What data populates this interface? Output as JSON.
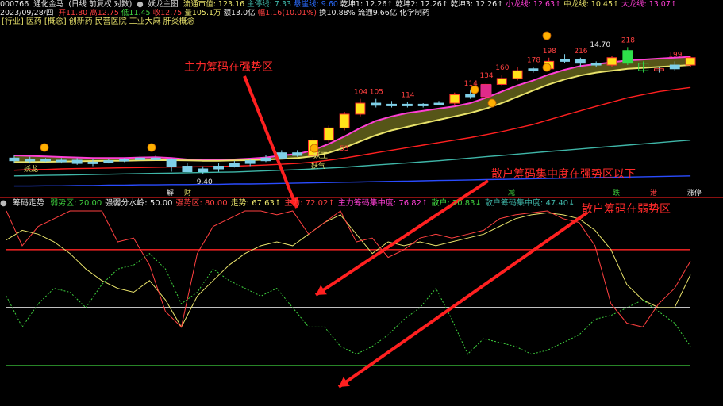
{
  "header": {
    "stock_code": "000766",
    "stock_name": "通化金马",
    "period": "(日线 前复权 对数)",
    "indicator_name": "妖龙主图",
    "items": [
      {
        "label": "流通市值: 123.16",
        "color": "#e8e26a"
      },
      {
        "label": "主停线: 7.33",
        "color": "#3fb6a8"
      },
      {
        "label": "悬崖线: 9.60",
        "color": "#2a6cff"
      },
      {
        "label": "乾坤1: 12.26↑",
        "color": "#e8e8e8"
      },
      {
        "label": "乾坤2: 12.26↑",
        "color": "#e8e8e8"
      },
      {
        "label": "乾坤3: 12.26↑",
        "color": "#e8e8e8"
      },
      {
        "label": "小龙线: 12.63↑",
        "color": "#ff3fd6"
      },
      {
        "label": "中龙线: 10.45↑",
        "color": "#e8e26a"
      },
      {
        "label": "大龙线: 13.07↑",
        "color": "#ff3fd6"
      }
    ]
  },
  "header2": {
    "date": "2023/09/28/四",
    "items": [
      {
        "label": "开11.80",
        "color": "#ff4040"
      },
      {
        "label": "高12.75",
        "color": "#ff4040"
      },
      {
        "label": "低11.45",
        "color": "#3fd23f"
      },
      {
        "label": "收12.75",
        "color": "#ff4040"
      },
      {
        "label": "量105.1万",
        "color": "#e8e26a"
      },
      {
        "label": "额13.0亿",
        "color": "#e8e8e8"
      },
      {
        "label": "幅1.16(10.01%)",
        "color": "#ff4040"
      },
      {
        "label": "换10.88%",
        "color": "#e8e8e8"
      },
      {
        "label": "流通9.66亿",
        "color": "#e8e8e8"
      },
      {
        "label": "化学制药",
        "color": "#e8e8e8"
      }
    ]
  },
  "concept_row": [
    "[行业]",
    "医药",
    "[概念]",
    "创新药",
    "民营医院",
    "工业大麻",
    "肝炎概念"
  ],
  "annotations": {
    "main_chip_strong": "主力筹码在强势区",
    "retail_below": "散户筹码集中度在强势区以下",
    "retail_weak": "散户筹码在弱势区"
  },
  "bottom_markers": [
    {
      "text": "解",
      "color": "#e8e8e8"
    },
    {
      "text": "财",
      "color": "#e8e26a"
    },
    {
      "text": "减",
      "color": "#3fd23f"
    },
    {
      "text": "跌",
      "color": "#3fd23f"
    },
    {
      "text": "港",
      "color": "#ff4040"
    },
    {
      "text": "涨停",
      "color": "#e8e8e8"
    }
  ],
  "sub_header": {
    "name": "筹码走势",
    "items": [
      {
        "label": "弱势区: 20.00",
        "color": "#3fd23f"
      },
      {
        "label": "强弱分水岭: 50.00",
        "color": "#e8e8e8"
      },
      {
        "label": "强势区: 80.00",
        "color": "#ff4040"
      },
      {
        "label": "走势: 67.63↑",
        "color": "#e8e26a"
      },
      {
        "label": "主力: 72.02↑",
        "color": "#ff4040"
      },
      {
        "label": "主力筹码集中度: 76.82↑",
        "color": "#ff3fd6"
      },
      {
        "label": "散户: 20.83↓",
        "color": "#3fd23f"
      },
      {
        "label": "散户筹码集中度: 47.40↓",
        "color": "#3fb6a8"
      }
    ]
  },
  "chart_data": [
    {
      "type": "candlestick",
      "title": "妖龙主图",
      "price_labels": [
        {
          "text": "53",
          "color": "#ff4040"
        },
        {
          "text": "104",
          "color": "#ff4040"
        },
        {
          "text": "105",
          "color": "#ff4040"
        },
        {
          "text": "114",
          "color": "#ff4040"
        },
        {
          "text": "114",
          "color": "#ff4040"
        },
        {
          "text": "134",
          "color": "#ff4040"
        },
        {
          "text": "160",
          "color": "#ff4040"
        },
        {
          "text": "178",
          "color": "#ff4040"
        },
        {
          "text": "198",
          "color": "#ff4040"
        },
        {
          "text": "216",
          "color": "#ff4040"
        },
        {
          "text": "14.70",
          "color": "#e8e8e8"
        },
        {
          "text": "218",
          "color": "#ff4040"
        },
        {
          "text": "199",
          "color": "#ff4040"
        },
        {
          "text": "9.40",
          "color": "#e8e8e8"
        }
      ],
      "text_marks": [
        "妖王",
        "妖气",
        "妖龙"
      ],
      "candles": [
        {
          "o": 9.9,
          "c": 9.8,
          "h": 10.0,
          "l": 9.7
        },
        {
          "o": 9.8,
          "c": 9.85,
          "h": 9.95,
          "l": 9.7
        },
        {
          "o": 9.85,
          "c": 9.8,
          "h": 9.9,
          "l": 9.75
        },
        {
          "o": 9.8,
          "c": 9.82,
          "h": 9.9,
          "l": 9.7
        },
        {
          "o": 9.82,
          "c": 9.7,
          "h": 9.9,
          "l": 9.65
        },
        {
          "o": 9.7,
          "c": 9.75,
          "h": 9.85,
          "l": 9.6
        },
        {
          "o": 9.75,
          "c": 9.8,
          "h": 9.85,
          "l": 9.7
        },
        {
          "o": 9.8,
          "c": 9.85,
          "h": 9.9,
          "l": 9.75
        },
        {
          "o": 9.85,
          "c": 9.9,
          "h": 10.0,
          "l": 9.8
        },
        {
          "o": 9.9,
          "c": 9.85,
          "h": 10.0,
          "l": 9.8
        },
        {
          "o": 9.85,
          "c": 9.6,
          "h": 9.9,
          "l": 9.4
        },
        {
          "o": 9.6,
          "c": 9.4,
          "h": 9.7,
          "l": 9.4
        },
        {
          "o": 9.4,
          "c": 9.5,
          "h": 9.6,
          "l": 9.3
        },
        {
          "o": 9.5,
          "c": 9.6,
          "h": 9.7,
          "l": 9.4
        },
        {
          "o": 9.6,
          "c": 9.7,
          "h": 9.8,
          "l": 9.55
        },
        {
          "o": 9.7,
          "c": 9.8,
          "h": 9.85,
          "l": 9.6
        },
        {
          "o": 9.8,
          "c": 9.9,
          "h": 10.0,
          "l": 9.75
        },
        {
          "o": 9.9,
          "c": 10.1,
          "h": 10.2,
          "l": 9.85
        },
        {
          "o": 10.1,
          "c": 10.0,
          "h": 10.2,
          "l": 9.95
        },
        {
          "o": 10.0,
          "c": 10.6,
          "h": 10.7,
          "l": 9.9
        },
        {
          "o": 10.6,
          "c": 11.1,
          "h": 11.2,
          "l": 10.5
        },
        {
          "o": 11.1,
          "c": 11.7,
          "h": 11.8,
          "l": 11.0
        },
        {
          "o": 11.7,
          "c": 12.2,
          "h": 12.4,
          "l": 11.6
        },
        {
          "o": 12.2,
          "c": 12.1,
          "h": 12.4,
          "l": 12.0
        },
        {
          "o": 12.1,
          "c": 12.15,
          "h": 12.3,
          "l": 12.0
        },
        {
          "o": 12.15,
          "c": 12.1,
          "h": 12.25,
          "l": 12.0
        },
        {
          "o": 12.1,
          "c": 12.15,
          "h": 12.2,
          "l": 12.0
        },
        {
          "o": 12.15,
          "c": 12.2,
          "h": 12.3,
          "l": 12.1
        },
        {
          "o": 12.2,
          "c": 12.6,
          "h": 12.7,
          "l": 12.1
        },
        {
          "o": 12.6,
          "c": 12.5,
          "h": 12.8,
          "l": 12.4
        },
        {
          "o": 12.5,
          "c": 13.1,
          "h": 13.2,
          "l": 12.4
        },
        {
          "o": 13.1,
          "c": 13.4,
          "h": 13.6,
          "l": 13.0
        },
        {
          "o": 13.4,
          "c": 13.8,
          "h": 14.0,
          "l": 13.3
        },
        {
          "o": 13.8,
          "c": 13.9,
          "h": 14.0,
          "l": 13.7
        },
        {
          "o": 13.9,
          "c": 14.3,
          "h": 14.5,
          "l": 13.8
        },
        {
          "o": 14.3,
          "c": 14.4,
          "h": 14.7,
          "l": 14.2
        },
        {
          "o": 14.4,
          "c": 14.2,
          "h": 14.5,
          "l": 14.0
        },
        {
          "o": 14.2,
          "c": 14.1,
          "h": 14.3,
          "l": 14.0
        },
        {
          "o": 14.1,
          "c": 14.5,
          "h": 14.6,
          "l": 14.0
        },
        {
          "o": 14.9,
          "c": 14.2,
          "h": 15.1,
          "l": 14.1
        },
        {
          "o": 14.2,
          "c": 13.8,
          "h": 14.3,
          "l": 13.7
        },
        {
          "o": 13.8,
          "c": 13.9,
          "h": 14.0,
          "l": 13.7
        },
        {
          "o": 13.9,
          "c": 14.1,
          "h": 14.3,
          "l": 13.8
        },
        {
          "o": 14.1,
          "c": 14.5,
          "h": 14.6,
          "l": 14.0
        }
      ],
      "lines": [
        {
          "name": "小龙线",
          "color": "#ff3fd6",
          "values": [
            10.0,
            9.98,
            9.96,
            9.94,
            9.92,
            9.9,
            9.9,
            9.9,
            9.92,
            9.93,
            9.9,
            9.85,
            9.82,
            9.82,
            9.85,
            9.88,
            9.92,
            10.0,
            10.05,
            10.2,
            10.45,
            10.75,
            11.1,
            11.4,
            11.6,
            11.75,
            11.85,
            11.95,
            12.05,
            12.2,
            12.45,
            12.75,
            13.05,
            13.3,
            13.6,
            13.85,
            14.05,
            14.15,
            14.25,
            14.35,
            14.4,
            14.45,
            14.5,
            14.55
          ]
        },
        {
          "name": "中龙线",
          "color": "#e8e26a",
          "values": [
            9.75,
            9.75,
            9.76,
            9.77,
            9.78,
            9.79,
            9.8,
            9.8,
            9.81,
            9.82,
            9.82,
            9.81,
            9.8,
            9.8,
            9.81,
            9.82,
            9.84,
            9.87,
            9.9,
            9.97,
            10.1,
            10.3,
            10.55,
            10.8,
            11.0,
            11.15,
            11.3,
            11.45,
            11.6,
            11.75,
            11.95,
            12.2,
            12.5,
            12.8,
            13.1,
            13.35,
            13.55,
            13.7,
            13.8,
            13.9,
            13.95,
            14.0,
            14.05,
            14.1
          ]
        },
        {
          "name": "大龙线",
          "color": "#ff2020",
          "values": [
            9.45,
            9.47,
            9.48,
            9.5,
            9.51,
            9.52,
            9.53,
            9.54,
            9.55,
            9.56,
            9.57,
            9.57,
            9.58,
            9.59,
            9.6,
            9.62,
            9.64,
            9.67,
            9.7,
            9.75,
            9.82,
            9.9,
            10.0,
            10.1,
            10.2,
            10.3,
            10.4,
            10.5,
            10.6,
            10.7,
            10.82,
            10.95,
            11.1,
            11.25,
            11.45,
            11.65,
            11.85,
            12.05,
            12.25,
            12.45,
            12.6,
            12.75,
            12.85,
            12.95
          ]
        },
        {
          "name": "主停线",
          "color": "#3fb6a8",
          "values": [
            9.25,
            9.26,
            9.27,
            9.28,
            9.29,
            9.3,
            9.31,
            9.32,
            9.33,
            9.34,
            9.35,
            9.36,
            9.37,
            9.38,
            9.39,
            9.41,
            9.43,
            9.45,
            9.47,
            9.5,
            9.53,
            9.56,
            9.6,
            9.64,
            9.68,
            9.72,
            9.76,
            9.8,
            9.85,
            9.9,
            9.95,
            10.0,
            10.05,
            10.1,
            10.15,
            10.2,
            10.25,
            10.3,
            10.35,
            10.4,
            10.45,
            10.5,
            10.55,
            10.6
          ]
        },
        {
          "name": "悬崖线",
          "color": "#2a4cff",
          "values": [
            8.9,
            8.9,
            8.91,
            8.91,
            8.92,
            8.92,
            8.93,
            8.93,
            8.94,
            8.94,
            8.95,
            8.95,
            8.96,
            8.96,
            8.97,
            8.97,
            8.98,
            8.99,
            9.0,
            9.01,
            9.02,
            9.03,
            9.04,
            9.05,
            9.06,
            9.07,
            9.08,
            9.09,
            9.1,
            9.11,
            9.12,
            9.13,
            9.14,
            9.15,
            9.16,
            9.17,
            9.18,
            9.19,
            9.2,
            9.21,
            9.22,
            9.23,
            9.24,
            9.25
          ]
        }
      ],
      "ylim": [
        8.6,
        16.2
      ]
    },
    {
      "type": "line",
      "title": "筹码走势",
      "ylim": [
        0,
        100
      ],
      "hlines": [
        {
          "name": "弱势区",
          "y": 20,
          "color": "#3fd23f"
        },
        {
          "name": "强弱分水岭",
          "y": 50,
          "color": "#ffffff"
        },
        {
          "name": "强势区",
          "y": 80,
          "color": "#e02020"
        }
      ],
      "series": [
        {
          "name": "走势",
          "color": "#e8e26a",
          "values": [
            85,
            90,
            88,
            84,
            78,
            70,
            64,
            60,
            58,
            64,
            54,
            40,
            56,
            64,
            72,
            78,
            82,
            84,
            82,
            88,
            94,
            98,
            88,
            78,
            84,
            82,
            84,
            82,
            84,
            86,
            88,
            92,
            96,
            98,
            99,
            98,
            96,
            90,
            80,
            62,
            54,
            50,
            50,
            67
          ]
        },
        {
          "name": "主力",
          "color": "#ff4040",
          "values": [
            100,
            82,
            92,
            96,
            100,
            100,
            100,
            84,
            86,
            72,
            48,
            40,
            78,
            92,
            96,
            100,
            100,
            98,
            100,
            88,
            94,
            100,
            84,
            86,
            76,
            80,
            86,
            88,
            86,
            88,
            90,
            96,
            98,
            99,
            100,
            96,
            94,
            82,
            52,
            42,
            40,
            52,
            60,
            74
          ]
        },
        {
          "name": "散户",
          "color": "#3fd23f",
          "dash": true,
          "values": [
            56,
            40,
            52,
            60,
            58,
            50,
            62,
            70,
            72,
            78,
            70,
            52,
            58,
            70,
            64,
            60,
            56,
            60,
            50,
            40,
            40,
            30,
            26,
            30,
            36,
            44,
            50,
            60,
            44,
            26,
            34,
            32,
            30,
            26,
            28,
            32,
            36,
            44,
            46,
            50,
            54,
            48,
            42,
            30
          ]
        }
      ]
    }
  ]
}
